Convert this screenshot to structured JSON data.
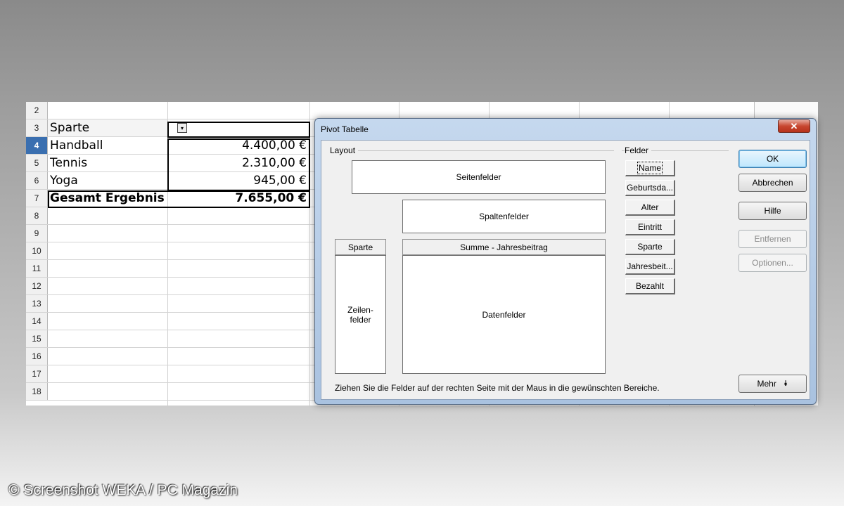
{
  "spreadsheet": {
    "rows": [
      {
        "num": "2",
        "a": "",
        "b": ""
      },
      {
        "num": "3",
        "a": "Sparte",
        "b": ""
      },
      {
        "num": "4",
        "a": "Handball",
        "b": "4.400,00 €"
      },
      {
        "num": "5",
        "a": "Tennis",
        "b": "2.310,00 €"
      },
      {
        "num": "6",
        "a": "Yoga",
        "b": "945,00 €"
      },
      {
        "num": "7",
        "a": "Gesamt Ergebnis",
        "b": "7.655,00 €"
      },
      {
        "num": "8",
        "a": "",
        "b": ""
      },
      {
        "num": "9",
        "a": "",
        "b": ""
      },
      {
        "num": "10",
        "a": "",
        "b": ""
      },
      {
        "num": "11",
        "a": "",
        "b": ""
      },
      {
        "num": "12",
        "a": "",
        "b": ""
      },
      {
        "num": "13",
        "a": "",
        "b": ""
      },
      {
        "num": "14",
        "a": "",
        "b": ""
      },
      {
        "num": "15",
        "a": "",
        "b": ""
      },
      {
        "num": "16",
        "a": "",
        "b": ""
      },
      {
        "num": "17",
        "a": "",
        "b": ""
      },
      {
        "num": "18",
        "a": "",
        "b": ""
      }
    ],
    "active_row": "4",
    "dropdown_glyph": "▾"
  },
  "dialog": {
    "title": "Pivot Tabelle",
    "close_glyph": "✕",
    "layout_label": "Layout",
    "felder_label": "Felder",
    "page_fields": "Seitenfelder",
    "column_fields": "Spaltenfelder",
    "row_field_button": "Sparte",
    "data_field_button": "Summe - Jahresbeitrag",
    "row_fields_line1": "Zeilen-",
    "row_fields_line2": "felder",
    "data_fields": "Datenfelder",
    "fields": [
      "Name",
      "Geburtsda...",
      "Alter",
      "Eintritt",
      "Sparte",
      "Jahresbeit...",
      "Bezahlt"
    ],
    "buttons": {
      "ok": "OK",
      "cancel": "Abbrechen",
      "help": "Hilfe",
      "remove": "Entfernen",
      "options": "Optionen...",
      "more": "Mehr",
      "more_glyph": "⯯"
    },
    "hint": "Ziehen Sie die Felder auf der rechten Seite mit der Maus in die gewünschten Bereiche."
  },
  "copyright": "© Screenshot WEKA / PC Magazin"
}
